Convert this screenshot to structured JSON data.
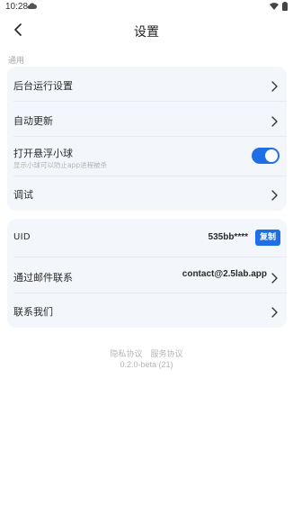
{
  "status_bar": {
    "time": "10:28",
    "left_icons": [
      "cloud-icon"
    ],
    "right_icons": [
      "wifi-icon",
      "battery-icon"
    ]
  },
  "header": {
    "title": "设置",
    "back_icon": "chevron-left-icon"
  },
  "section_general": {
    "label": "通用",
    "items": [
      {
        "label": "后台运行设置"
      },
      {
        "label": "自动更新"
      },
      {
        "label": "打开悬浮小球",
        "sub": "显示小球可以防止app进程被杀",
        "toggle_on": true
      },
      {
        "label": "调试"
      }
    ]
  },
  "section_account": {
    "uid_label": "UID",
    "uid_value": "535bb****",
    "copy_label": "复制",
    "email_label": "通过邮件联系",
    "email_value": "contact@2.5lab.app",
    "contact_label": "联系我们"
  },
  "footer": {
    "privacy_label": "隐私协议",
    "service_label": "服务协议",
    "version": "0.2.0-beta (21)"
  },
  "colors": {
    "accent": "#1e6fe6",
    "card_bg": "#f3f6fb",
    "muted_text": "#b5b5b5"
  }
}
